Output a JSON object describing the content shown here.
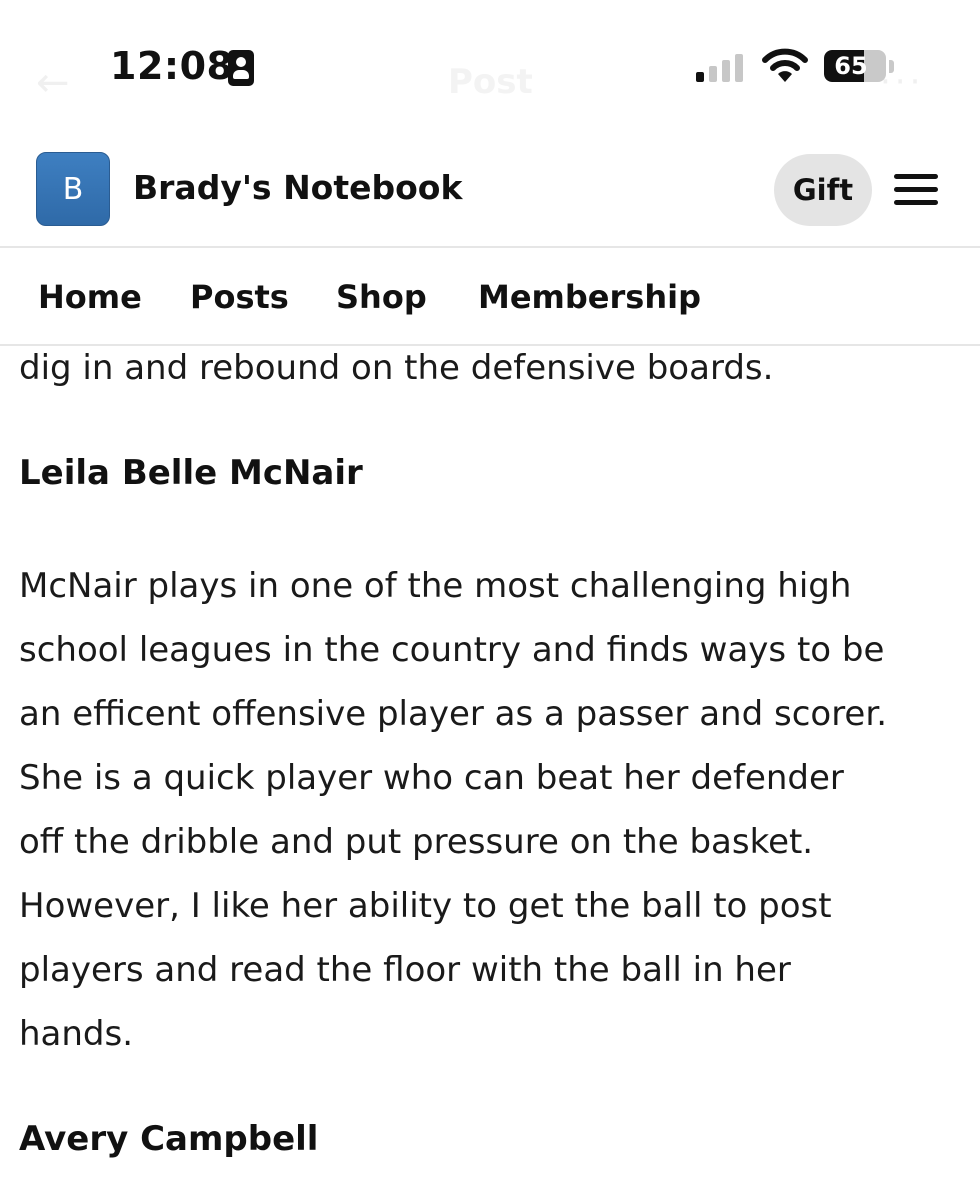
{
  "status_bar": {
    "time": "12:08",
    "battery_level": "65",
    "battery_fraction": 0.65,
    "ghost_title": "Post",
    "icons": [
      "id-card-icon",
      "cellular-signal-icon",
      "wifi-icon",
      "battery-icon"
    ]
  },
  "publication": {
    "avatar_letter": "B",
    "name": "Brady's Notebook",
    "gift_label": "Gift",
    "avatar_color": "#3677b8"
  },
  "nav": {
    "items": [
      "Home",
      "Posts",
      "Shop",
      "Membership"
    ]
  },
  "article": {
    "partial_line": "dig in and rebound on the defensive boards.",
    "sections": [
      {
        "heading": "Leila Belle McNair",
        "lines": [
          "McNair plays in one of the most challenging high",
          "school leagues in the country and finds ways to be",
          "an efficent offensive player as a passer and scorer.",
          "She is a quick player who can beat her defender",
          "off the dribble and put pressure on the basket.",
          "However, I like her ability to get the ball to post",
          "players and read the floor with the ball in her",
          "hands."
        ]
      },
      {
        "heading": "Avery Campbell"
      }
    ]
  }
}
